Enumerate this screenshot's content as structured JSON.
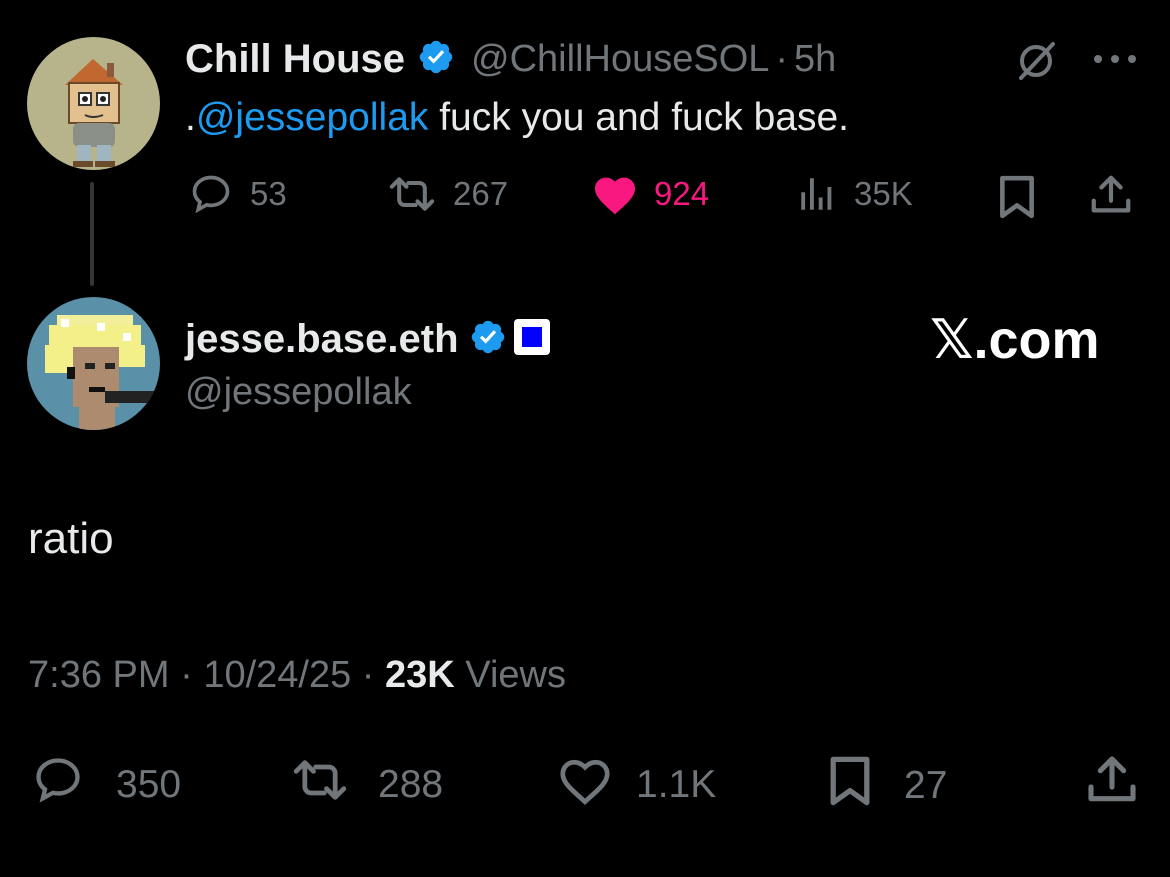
{
  "parent_tweet": {
    "display_name": "Chill House",
    "handle": "@ChillHouseSOL",
    "separator": "·",
    "time": "5h",
    "text_prefix": ".",
    "mention": "@jessepollak",
    "text_rest": " fuck you and fuck base.",
    "stats": {
      "replies": "53",
      "reposts": "267",
      "likes": "924",
      "views": "35K"
    },
    "liked": true
  },
  "reply_tweet": {
    "display_name": "jesse.base.eth",
    "handle": "@jessepollak",
    "text": "ratio",
    "time": "7:36 PM",
    "date": "10/24/25",
    "views_count": "23K",
    "views_label": "Views",
    "separator": "·",
    "stats": {
      "replies": "350",
      "reposts": "288",
      "likes": "1.1K",
      "bookmarks": "27"
    }
  },
  "watermark": "𝕏.com",
  "colors": {
    "accent": "#1d9bf0",
    "like": "#f91880",
    "muted": "#71767b",
    "text": "#e7e9ea",
    "background": "#000000"
  },
  "icons": [
    "grok-icon",
    "more-icon",
    "reply-icon",
    "repost-icon",
    "like-icon",
    "views-icon",
    "bookmark-icon",
    "share-icon",
    "verified-badge-icon",
    "base-square-icon"
  ]
}
